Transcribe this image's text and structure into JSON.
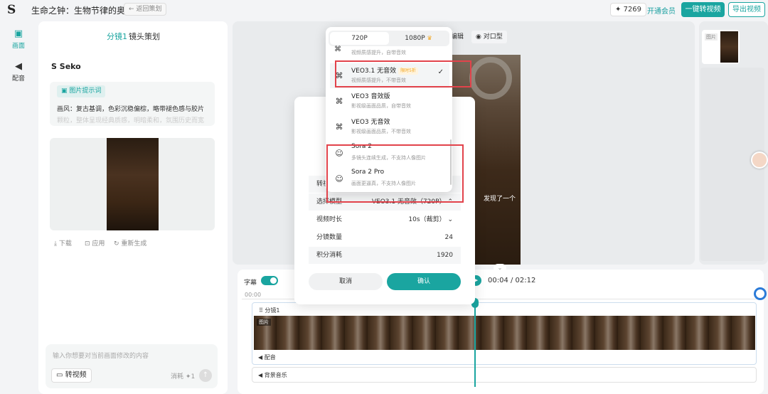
{
  "topbar": {
    "title": "生命之钟：生物节律的奥秘",
    "back_label": "返回策划",
    "credits": "7269",
    "vip_label": "开通会员",
    "convert_label": "一键转视频",
    "export_label": "导出视频"
  },
  "leftnav": {
    "items": [
      {
        "label": "画面",
        "icon": "image-icon"
      },
      {
        "label": "配音",
        "icon": "speaker-icon"
      }
    ]
  },
  "leftpanel": {
    "tab_active": "分镜1",
    "tab_title": "镜头策划",
    "brand": "Seko",
    "prompt_tag": "图片提示词",
    "prompt_text": "画风：复古基调，色彩沉稳偏棕，略带褪色感与胶片",
    "prompt_text_faded": "颗粒，整体呈现经典质感，明暗柔和，氛围历史而宽",
    "actions": [
      "下载",
      "应用",
      "重新生成"
    ],
    "input_placeholder": "输入你想要对当前画面修改的内容",
    "video_button": "转视频",
    "cost_label": "消耗",
    "cost_value": "1"
  },
  "center": {
    "edit_label": "编辑",
    "lip_label": "对口型",
    "caption_peek": "发现了一个"
  },
  "right": {
    "thumb_tag": "图片"
  },
  "timeline": {
    "subtitle_label": "字幕",
    "time_start": "00:00",
    "time_display": "00:04 / 02:12",
    "track_label": "分镜1",
    "frames_tag": "图片",
    "dub_label": "配音",
    "music_label": "背景音乐"
  },
  "modal": {
    "head_row_label": "转视",
    "rows": [
      {
        "label": "选择模型",
        "value": "VEO3.1 无音效（720P）"
      },
      {
        "label": "视频时长",
        "value": "10s（裁剪）"
      },
      {
        "label": "分镜数量",
        "value": "24"
      },
      {
        "label": "积分消耗",
        "value": "1920"
      }
    ],
    "cancel_label": "取消",
    "confirm_label": "确认"
  },
  "dropdown": {
    "res_tabs": [
      "720P",
      "1080P"
    ],
    "partial_desc": "视频质感提升，自带音效",
    "items": [
      {
        "name": "VEO3.1 无音效",
        "badge": "限时5折",
        "desc": "视频质感提升，不带音效",
        "selected": true,
        "icon": "veo-icon"
      },
      {
        "name": "VEO3 音效版",
        "badge": "",
        "desc": "影视级画面品质，自带音效",
        "selected": false,
        "icon": "veo-icon"
      },
      {
        "name": "VEO3 无音效",
        "badge": "",
        "desc": "影视级画面品质，不带音效",
        "selected": false,
        "icon": "veo-icon"
      },
      {
        "name": "Sora 2",
        "badge": "",
        "desc": "多镜头连续生成，不支持人像图片",
        "selected": false,
        "icon": "sora-icon"
      },
      {
        "name": "Sora 2 Pro",
        "badge": "",
        "desc": "画面更逼真，不支持人像图片",
        "selected": false,
        "icon": "sora-icon"
      }
    ],
    "check_glyph": "✓"
  },
  "colors": {
    "accent": "#1aa5a0",
    "highlight_box": "#e2434b",
    "badge": "#f2a51e"
  }
}
